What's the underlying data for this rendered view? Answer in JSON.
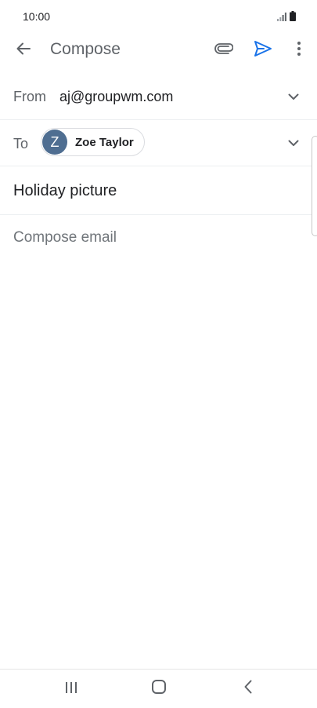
{
  "status_bar": {
    "time": "10:00",
    "icons": [
      "signal-icon",
      "battery-icon"
    ]
  },
  "app_bar": {
    "title": "Compose",
    "icons": [
      "back-arrow-icon",
      "paperclip-icon",
      "send-icon",
      "more-vert-icon"
    ],
    "accent_color": "#1a73e8"
  },
  "from_field": {
    "label": "From",
    "value": "aj@groupwm.com"
  },
  "to_field": {
    "label": "To",
    "recipients": [
      {
        "initial": "Z",
        "name": "Zoe Taylor",
        "avatar_color": "#4f6e91"
      }
    ]
  },
  "subject": {
    "value": "Holiday picture"
  },
  "body": {
    "placeholder": "Compose email"
  },
  "nav_bar": {
    "icons": [
      "recent-apps-icon",
      "home-icon",
      "back-icon"
    ]
  }
}
